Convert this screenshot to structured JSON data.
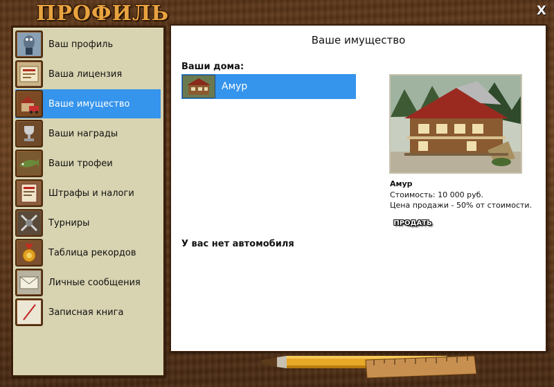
{
  "window": {
    "title": "ПРОФИЛЬ",
    "close_label": "X"
  },
  "sidebar": {
    "items": [
      {
        "label": "Ваш профиль",
        "icon": "fish-avatar-icon"
      },
      {
        "label": "Ваша лицензия",
        "icon": "license-icon"
      },
      {
        "label": "Ваше имущество",
        "icon": "house-car-icon",
        "active": true
      },
      {
        "label": "Ваши награды",
        "icon": "trophy-icon"
      },
      {
        "label": "Ваши трофеи",
        "icon": "pike-fish-icon"
      },
      {
        "label": "Штрафы и налоги",
        "icon": "fine-notice-icon"
      },
      {
        "label": "Турниры",
        "icon": "crossed-swords-icon"
      },
      {
        "label": "Таблица рекордов",
        "icon": "medal-icon"
      },
      {
        "label": "Личные сообщения",
        "icon": "envelope-icon"
      },
      {
        "label": "Записная книга",
        "icon": "notebook-icon"
      }
    ]
  },
  "main": {
    "title": "Ваше имущество",
    "houses_label": "Ваши дома:",
    "houses": [
      {
        "name": "Амур"
      }
    ],
    "detail": {
      "name": "Амур",
      "cost": "Стоимость: 10 000 руб.",
      "sale": "Цена продажи - 50% от стоимости.",
      "sell_label": "ПРОДАТЬ"
    },
    "no_car": "У вас нет автомобиля"
  },
  "colors": {
    "active_item": "#3594ec",
    "sidebar_bg": "#d8d3b0",
    "title_text": "#e8a340",
    "wood": "#5a3518"
  }
}
